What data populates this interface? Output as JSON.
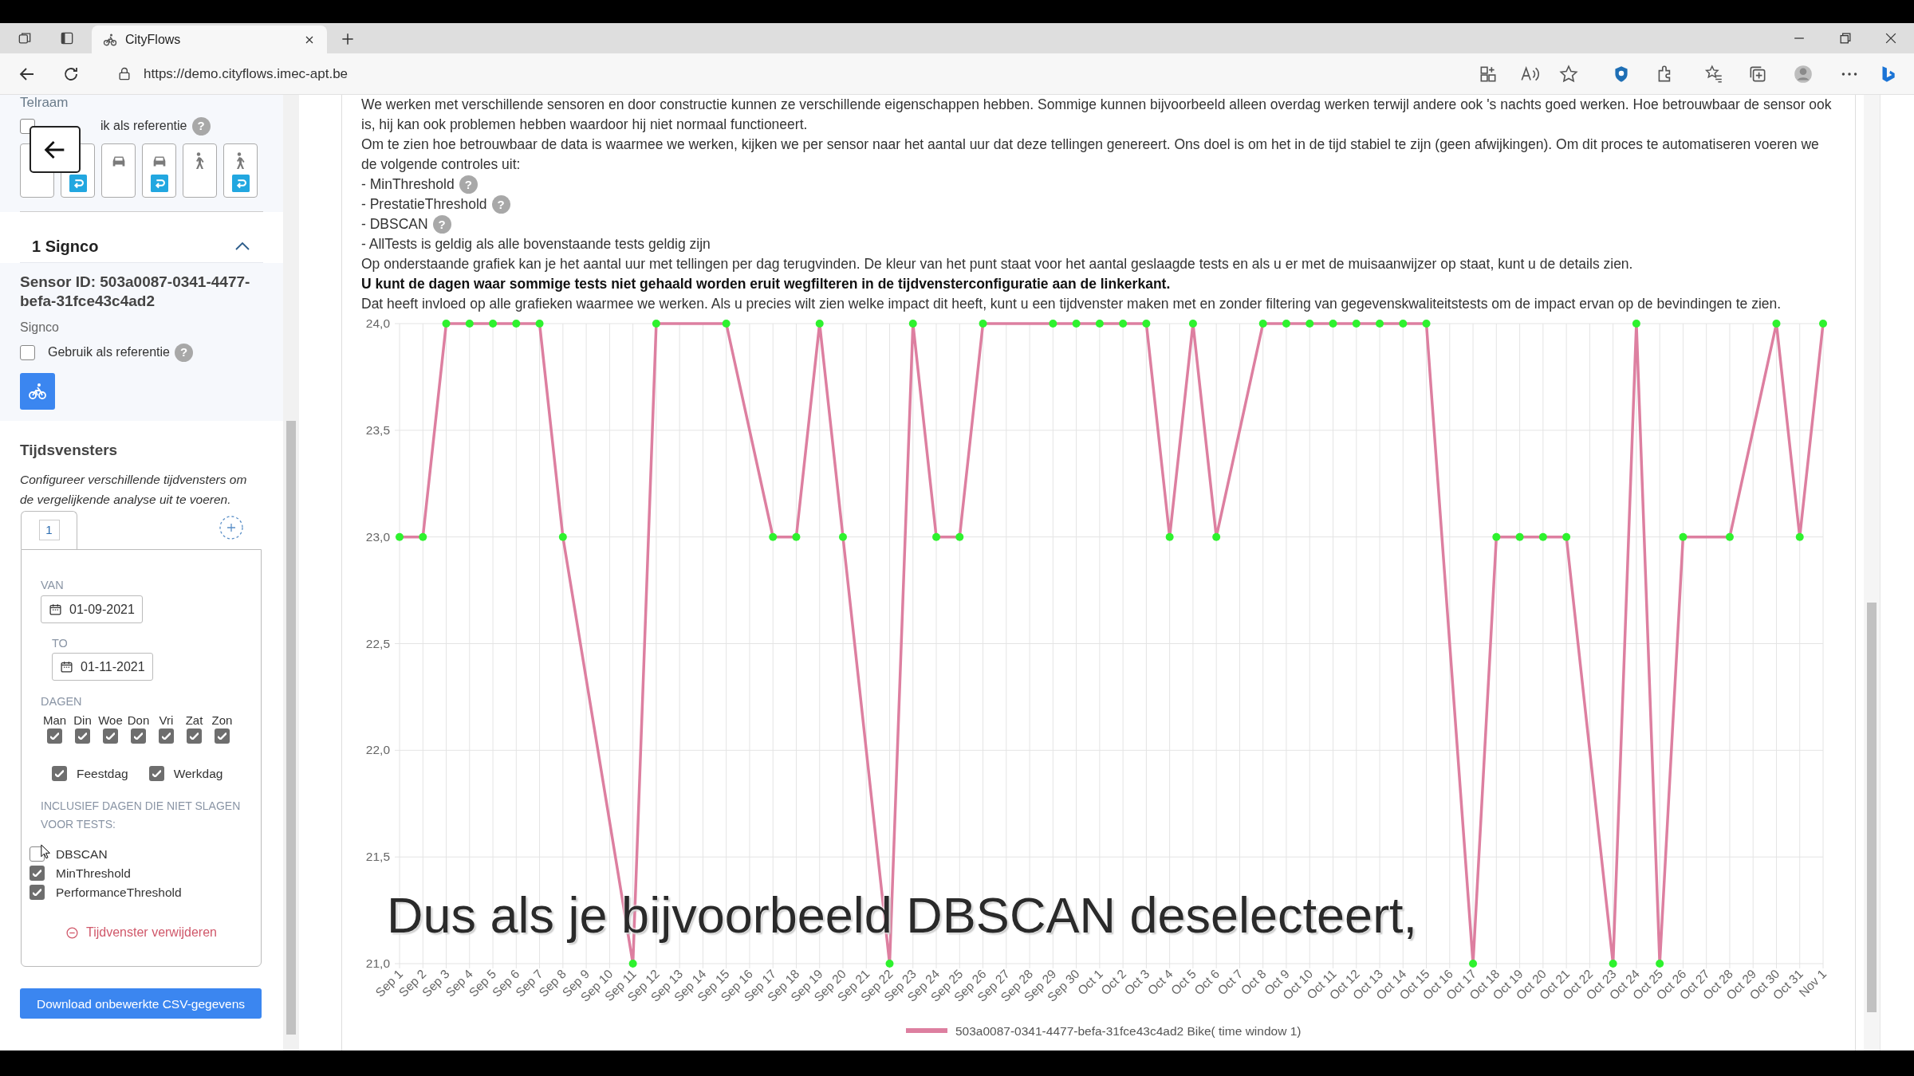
{
  "browser": {
    "tab_title": "CityFlows",
    "url": "https://demo.cityflows.imec-apt.be"
  },
  "sidebar": {
    "telraam": {
      "title": "Telraam",
      "reference_label": "ik als referentie",
      "reference_checked": false,
      "help": "?",
      "modes": [
        {
          "kind": "blank",
          "return": false
        },
        {
          "kind": "blank",
          "return": true
        },
        {
          "kind": "car",
          "return": false
        },
        {
          "kind": "car",
          "return": true
        },
        {
          "kind": "pedestrian",
          "return": false
        },
        {
          "kind": "pedestrian",
          "return": true
        }
      ]
    },
    "signco": {
      "title": "1 Signco",
      "expanded": true,
      "sensor_id": "Sensor ID: 503a0087-0341-4477-befa-31fce43c4ad2",
      "source": "Signco",
      "reference_label": "Gebruik als referentie",
      "reference_checked": false,
      "help": "?",
      "modes": [
        {
          "kind": "bike",
          "selected": true
        }
      ]
    },
    "time_windows": {
      "title": "Tijdsvensters",
      "description": "Configureer verschillende tijdvensters om de vergelijkende analyse uit te voeren.",
      "tabs": [
        {
          "label": "1",
          "selected": true
        }
      ],
      "from_label": "VAN",
      "from": "01-09-2021",
      "to_label": "TO",
      "to": "01-11-2021",
      "days_label": "DAGEN",
      "days": [
        {
          "label": "Man",
          "checked": true
        },
        {
          "label": "Din",
          "checked": true
        },
        {
          "label": "Woe",
          "checked": true
        },
        {
          "label": "Don",
          "checked": true
        },
        {
          "label": "Vri",
          "checked": true
        },
        {
          "label": "Zat",
          "checked": true
        },
        {
          "label": "Zon",
          "checked": true
        }
      ],
      "day_types": [
        {
          "label": "Feestdag",
          "checked": true
        },
        {
          "label": "Werkdag",
          "checked": true
        }
      ],
      "tests_label": "INCLUSIEF DAGEN DIE NIET SLAGEN VOOR TESTS:",
      "tests": [
        {
          "label": "DBSCAN",
          "checked": false
        },
        {
          "label": "MinThreshold",
          "checked": true
        },
        {
          "label": "PerformanceThreshold",
          "checked": true
        }
      ],
      "remove": "Tijdvenster verwijderen"
    },
    "download": "Download onbewerkte CSV-gegevens"
  },
  "main": {
    "paragraphs": [
      {
        "text": "We werken met verschillende sensoren en door constructie kunnen ze verschillende eigenschappen hebben. Sommige kunnen bijvoorbeeld alleen overdag werken terwijl andere ook 's nachts goed werken. Hoe betrouwbaar de sensor ook is, hij kan ook problemen hebben waardoor hij niet normaal functioneert.",
        "bold": false
      },
      {
        "text": "Om te zien hoe betrouwbaar de data is waarmee we werken, kijken we per sensor naar het aantal uur dat deze tellingen genereert. Ons doel is om het in de tijd stabiel te zijn (geen afwijkingen). Om dit proces te automatiseren voeren we de volgende controles uit:",
        "bold": false
      },
      {
        "text": "- MinThreshold",
        "bold": false,
        "help": "?"
      },
      {
        "text": "- PrestatieThreshold",
        "bold": false,
        "help": "?"
      },
      {
        "text": "- DBSCAN",
        "bold": false,
        "help": "?"
      },
      {
        "text": "- AllTests is geldig als alle bovenstaande tests geldig zijn",
        "bold": false
      },
      {
        "text": "Op onderstaande grafiek kan je het aantal uur met tellingen per dag terugvinden. De kleur van het punt staat voor het aantal geslaagde tests en als u er met de muisaanwijzer op staat, kunt u de details zien.",
        "bold": false
      },
      {
        "text": "U kunt de dagen waar sommige tests niet gehaald worden eruit wegfilteren in de tijdvensterconfiguratie aan de linkerkant.",
        "bold": true
      },
      {
        "text": "Dat heeft invloed op alle grafieken waarmee we werken. Als u precies wilt zien welke impact dit heeft, kunt u een tijdvenster maken met en zonder filtering van gegevenskwaliteitstests om de impact ervan op de bevindingen te zien.",
        "bold": false
      }
    ],
    "chart_data": {
      "type": "line",
      "grid": true,
      "ylim": [
        21,
        24
      ],
      "yticks": [
        {
          "value": 21,
          "label": "21,0"
        },
        {
          "value": 21.5,
          "label": "21,5"
        },
        {
          "value": 22,
          "label": "22,0"
        },
        {
          "value": 22.5,
          "label": "22,5"
        },
        {
          "value": 23,
          "label": "23,0"
        },
        {
          "value": 23.5,
          "label": "23,5"
        },
        {
          "value": 24,
          "label": "24,0"
        }
      ],
      "categories": [
        "Sep 1",
        "Sep 2",
        "Sep 3",
        "Sep 4",
        "Sep 5",
        "Sep 6",
        "Sep 7",
        "Sep 8",
        "Sep 9",
        "Sep 10",
        "Sep 11",
        "Sep 12",
        "Sep 13",
        "Sep 14",
        "Sep 15",
        "Sep 16",
        "Sep 17",
        "Sep 18",
        "Sep 19",
        "Sep 20",
        "Sep 21",
        "Sep 22",
        "Sep 23",
        "Sep 24",
        "Sep 25",
        "Sep 26",
        "Sep 27",
        "Sep 28",
        "Sep 29",
        "Sep 30",
        "Oct 1",
        "Oct 2",
        "Oct 3",
        "Oct 4",
        "Oct 5",
        "Oct 6",
        "Oct 7",
        "Oct 8",
        "Oct 9",
        "Oct 10",
        "Oct 11",
        "Oct 12",
        "Oct 13",
        "Oct 14",
        "Oct 15",
        "Oct 16",
        "Oct 17",
        "Oct 18",
        "Oct 19",
        "Oct 20",
        "Oct 21",
        "Oct 22",
        "Oct 23",
        "Oct 24",
        "Oct 25",
        "Oct 26",
        "Oct 27",
        "Oct 28",
        "Oct 29",
        "Oct 30",
        "Oct 31",
        "Nov 1"
      ],
      "series": [
        {
          "name": "503a0087-0341-4477-befa-31fce43c4ad2  Bike( time window 1)",
          "color": "#dd7fa0",
          "marker": "circle",
          "values": [
            23,
            23,
            24,
            24,
            24,
            24,
            24,
            23,
            null,
            null,
            21,
            24,
            null,
            null,
            24,
            null,
            23,
            23,
            24,
            23,
            null,
            21,
            24,
            23,
            23,
            24,
            null,
            null,
            24,
            24,
            24,
            24,
            24,
            23,
            24,
            23,
            null,
            24,
            24,
            24,
            24,
            24,
            24,
            24,
            24,
            null,
            21,
            23,
            23,
            23,
            23,
            null,
            21,
            24,
            21,
            23,
            null,
            23,
            null,
            24,
            23,
            24
          ]
        }
      ]
    }
  },
  "caption": "Dus als je bijvoorbeeld DBSCAN deselecteert,"
}
